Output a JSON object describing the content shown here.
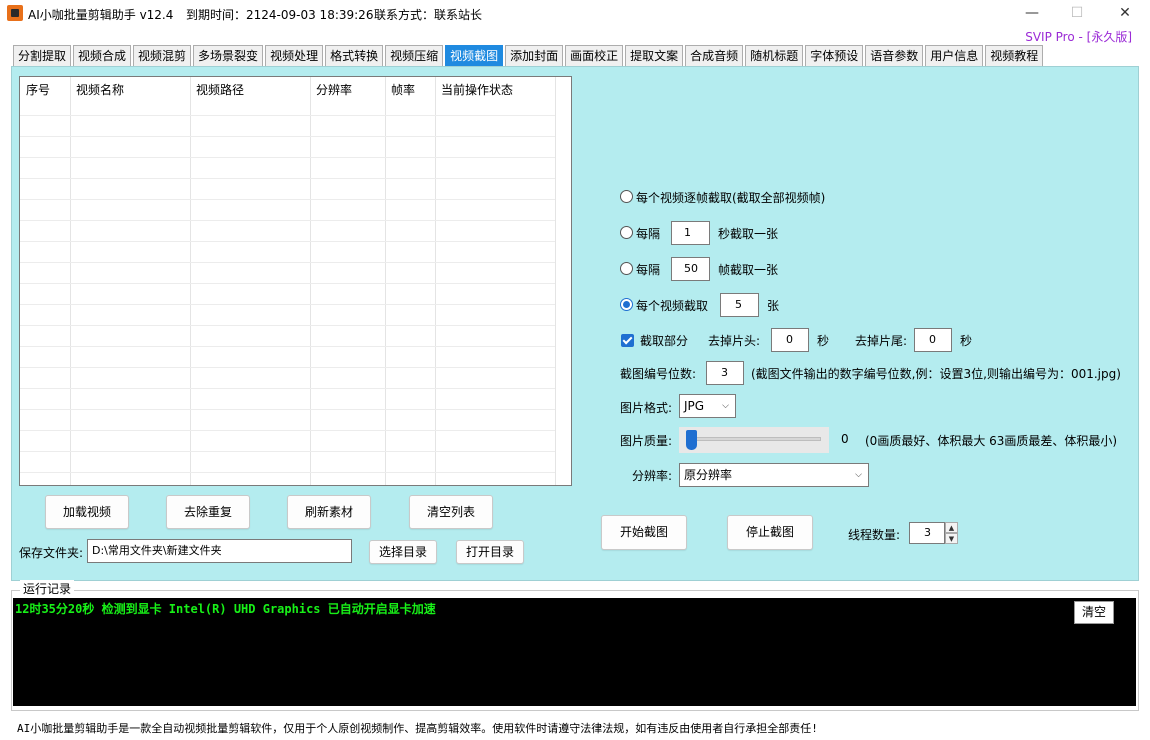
{
  "titlebar": {
    "app_title": "AI小咖批量剪辑助手 v12.4",
    "expire": "到期时间：2124-09-03 18:39:26",
    "contact": "联系方式：联系站长",
    "minimize": "—",
    "maximize": "☐",
    "close": "✕",
    "edition": "SVIP Pro - [永久版]"
  },
  "tabs": [
    "分割提取",
    "视频合成",
    "视频混剪",
    "多场景裂变",
    "视频处理",
    "格式转换",
    "视频压缩",
    "视频截图",
    "添加封面",
    "画面校正",
    "提取文案",
    "合成音频",
    "随机标题",
    "字体预设",
    "语音参数",
    "用户信息",
    "视频教程"
  ],
  "active_tab": "视频截图",
  "grid": {
    "columns": [
      "序号",
      "视频名称",
      "视频路径",
      "分辨率",
      "帧率",
      "当前操作状态"
    ]
  },
  "buttons": {
    "load": "加载视频",
    "dedupe": "去除重复",
    "refresh": "刷新素材",
    "clear_list": "清空列表",
    "choose_dir": "选择目录",
    "open_dir": "打开目录",
    "start": "开始截图",
    "stop": "停止截图"
  },
  "save": {
    "label": "保存文件夹:",
    "path": "D:\\常用文件夹\\新建文件夹"
  },
  "options": {
    "mode_all": "每个视频逐帧截取(截取全部视频帧)",
    "mode_seconds_prefix": "每隔",
    "seconds_value": "1",
    "mode_seconds_suffix": "秒截取一张",
    "mode_frames_prefix": "每隔",
    "frames_value": "50",
    "mode_frames_suffix": "帧截取一张",
    "mode_count_prefix": "每个视频截取",
    "count_value": "5",
    "mode_count_suffix": "张",
    "partial_label": "截取部分",
    "head_label": "去掉片头:",
    "head_value": "0",
    "head_unit": "秒",
    "tail_label": "去掉片尾:",
    "tail_value": "0",
    "tail_unit": "秒",
    "digits_label": "截图编号位数:",
    "digits_value": "3",
    "digits_hint": "(截图文件输出的数字编号位数,例：设置3位,则输出编号为：001.jpg)",
    "format_label": "图片格式:",
    "format_value": "JPG",
    "quality_label": "图片质量:",
    "quality_value": "0",
    "quality_hint": "(0画质最好、体积最大 63画质最差、体积最小)",
    "resolution_label": "分辨率:",
    "resolution_value": "原分辨率",
    "threads_label": "线程数量:",
    "threads_value": "3"
  },
  "log": {
    "title": "运行记录",
    "line": "12时35分20秒 检测到显卡 Intel(R) UHD Graphics 已自动开启显卡加速",
    "clear": "清空"
  },
  "footer": "AI小咖批量剪辑助手是一款全自动视频批量剪辑软件，仅用于个人原创视频制作、提高剪辑效率。使用软件时请遵守法律法规，如有违反由使用者自行承担全部责任!",
  "colors": {
    "panel": "#b4ecef",
    "active_tab": "#1f8ae0",
    "accent": "#1f6fd1",
    "log_text": "#18f018",
    "edition": "#9b2bd6"
  }
}
